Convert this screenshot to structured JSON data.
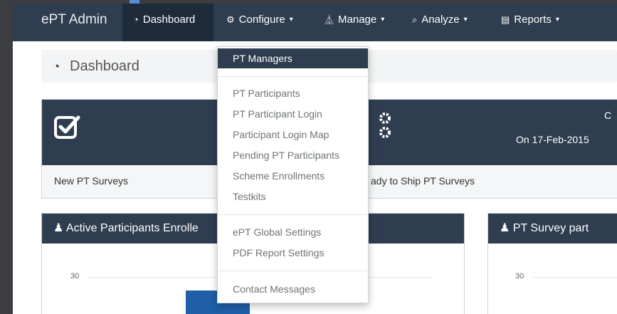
{
  "navbar": {
    "brand": "ePT Admin",
    "items": [
      {
        "label": "Dashboard",
        "icon": "dashboard-icon",
        "caret": ""
      },
      {
        "label": "Configure",
        "icon": "gear-icon",
        "caret": "▾"
      },
      {
        "label": "Manage",
        "icon": "flask-icon",
        "caret": "▾"
      },
      {
        "label": "Analyze",
        "icon": "search-icon",
        "caret": "▾"
      },
      {
        "label": "Reports",
        "icon": "bar-chart-icon",
        "caret": "▾"
      }
    ]
  },
  "breadcrumb": {
    "label": "Dashboard"
  },
  "panels": {
    "new_surveys": {
      "footer": "New PT Surveys"
    },
    "ready_ship": {
      "date_text": "On 17-Feb-2015",
      "footer_partial": "ady to Ship PT Surveys"
    },
    "active_participants": {
      "title": "Active Participants Enrolle",
      "tick": "30"
    },
    "survey_participation": {
      "title": "PT Survey part",
      "tick": "30"
    }
  },
  "dropdown": {
    "groups": [
      [
        "PT Managers"
      ],
      [
        "PT Participants",
        "PT Participant Login",
        "Participant Login Map",
        "Pending PT Participants",
        "Scheme Enrollments",
        "Testkits"
      ],
      [
        "ePT Global Settings",
        "PDF Report Settings"
      ],
      [
        "Contact Messages"
      ]
    ],
    "active_item": "PT Managers"
  },
  "colors": {
    "navbar": "#2e3d50",
    "bar": "#1f5fa6",
    "accent": "#5a8dd6"
  }
}
